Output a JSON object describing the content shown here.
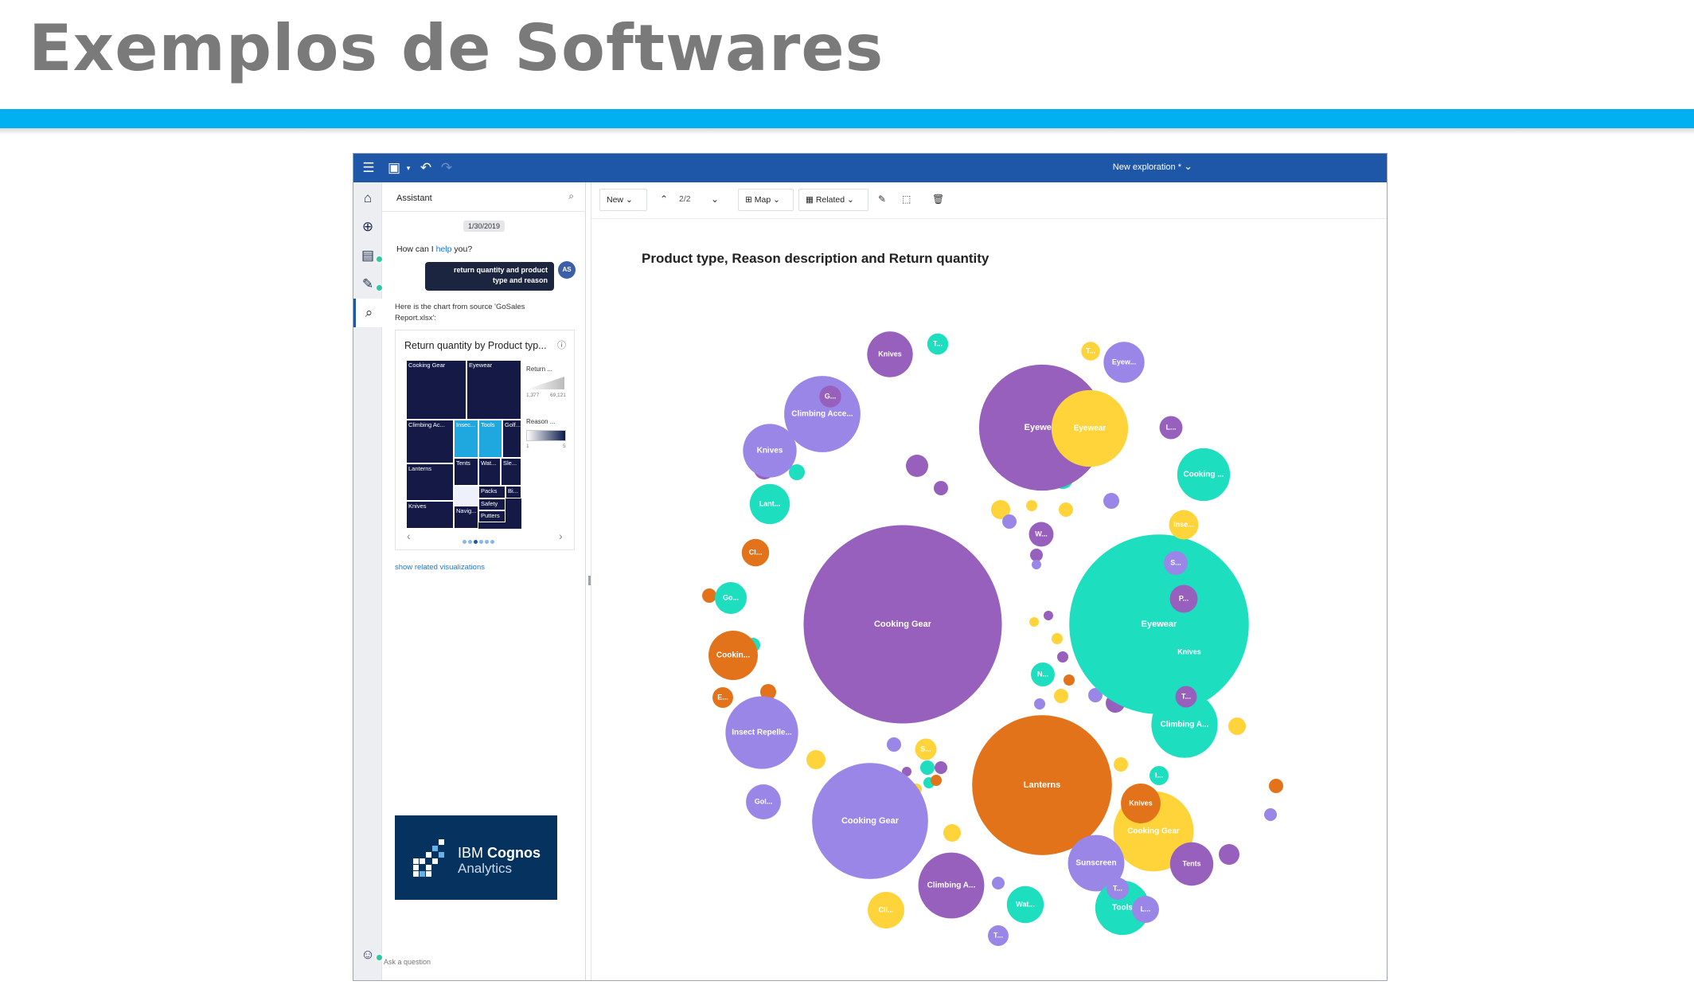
{
  "slide": {
    "title": "Exemplos de Softwares",
    "accent_color": "#00b0f0"
  },
  "app": {
    "topbar": {
      "exploration_title": "New exploration *",
      "color": "#1f57a8"
    },
    "rail": {
      "items": [
        "home",
        "explore",
        "data",
        "pinboard",
        "assistant"
      ]
    },
    "assistant": {
      "title": "Assistant",
      "date": "1/30/2019",
      "question_prefix": "How can I ",
      "question_link": "help",
      "question_suffix": " you?",
      "user_message_line1": "return quantity and product",
      "user_message_line2": "type and reason",
      "avatar": "AS",
      "answer": "Here is the chart from source 'GoSales Report.xlsx':",
      "mini_chart": {
        "title": "Return quantity by Product typ...",
        "legend_return": "Return ...",
        "legend_return_min": "1,377",
        "legend_return_max": "69,121",
        "legend_reason": "Reason ...",
        "legend_reason_min": "1",
        "legend_reason_max": "5",
        "cells": [
          "Cooking Gear",
          "Eyewear",
          "Climbing Ac...",
          "Insec...",
          "Tools",
          "Golf...",
          "Lanterns",
          "Tents",
          "Wat...",
          "Sle...",
          "Knives",
          "Packs",
          "Bi...",
          "Navig...",
          "Safety",
          "Putters"
        ]
      },
      "related_link": "show related visualizations",
      "logo_brand": "IBM",
      "logo_product": "Cognos",
      "logo_sub": "Analytics",
      "ask_placeholder": "Ask a question"
    },
    "toolbar": {
      "new_label": "New",
      "page": "2/2",
      "map_label": "Map",
      "related_label": "Related"
    }
  },
  "chart_data": {
    "type": "packed-bubble",
    "title": "Product type, Reason description and Return quantity",
    "colors": {
      "purple": "#9660bc",
      "lavender": "#9a86e6",
      "teal": "#1edec0",
      "yellow": "#ffd33a",
      "orange": "#e2731a"
    },
    "bubbles": [
      {
        "label": "Cooking Gear",
        "color": "purple",
        "size": 49.9
      },
      {
        "label": "Eyewear",
        "color": "teal",
        "size": 45.2
      },
      {
        "label": "Lanterns",
        "color": "orange",
        "size": 35.2
      },
      {
        "label": "Eyewear",
        "color": "purple",
        "size": 31.7
      },
      {
        "label": "Cooking Gear",
        "color": "lavender",
        "size": 29.2
      },
      {
        "label": "Climbing Acce...",
        "color": "lavender",
        "size": 19.2
      },
      {
        "label": "Cooking Gear",
        "color": "yellow",
        "size": 20.2
      },
      {
        "label": "Eyewear",
        "color": "yellow",
        "size": 19.3
      },
      {
        "label": "Climbing A...",
        "color": "purple",
        "size": 16.6
      },
      {
        "label": "Climbing A...",
        "color": "teal",
        "size": 16.7
      },
      {
        "label": "Insect Repelle...",
        "color": "lavender",
        "size": 18.3
      },
      {
        "label": "Sunscreen",
        "color": "lavender",
        "size": 14.2
      },
      {
        "label": "Knives",
        "color": "lavender",
        "size": 13.5
      },
      {
        "label": "Cookin...",
        "color": "orange",
        "size": 12.4
      },
      {
        "label": "Cooking ...",
        "color": "teal",
        "size": 13.3
      },
      {
        "label": "Knives",
        "color": "teal",
        "size": 12.0
      },
      {
        "label": "Knives",
        "color": "purple",
        "size": 11.5
      },
      {
        "label": "Tools",
        "color": "teal",
        "size": 13.7
      },
      {
        "label": "Tents",
        "color": "purple",
        "size": 10.9
      },
      {
        "label": "Knives",
        "color": "orange",
        "size": 10.0
      },
      {
        "label": "Eyew...",
        "color": "lavender",
        "size": 10.3
      },
      {
        "label": "Lant...",
        "color": "teal",
        "size": 10.1
      },
      {
        "label": "Go...",
        "color": "teal",
        "size": 8.0
      },
      {
        "label": "Gol...",
        "color": "lavender",
        "size": 8.8
      },
      {
        "label": "Wat...",
        "color": "teal",
        "size": 9.3
      },
      {
        "label": "Cli...",
        "color": "yellow",
        "size": 9.2
      },
      {
        "label": "Inse...",
        "color": "yellow",
        "size": 7.4
      },
      {
        "label": "P...",
        "color": "purple",
        "size": 7.0
      },
      {
        "label": "S...",
        "color": "lavender",
        "size": 6.0
      },
      {
        "label": "Cl...",
        "color": "orange",
        "size": 6.9
      },
      {
        "label": "L...",
        "color": "purple",
        "size": 5.8
      },
      {
        "label": "L...",
        "color": "lavender",
        "size": 6.8
      },
      {
        "label": "T...",
        "color": "teal",
        "size": 5.3
      },
      {
        "label": "T...",
        "color": "purple",
        "size": 5.4
      },
      {
        "label": "T...",
        "color": "lavender",
        "size": 5.6
      },
      {
        "label": "T...",
        "color": "lavender",
        "size": 5.2
      },
      {
        "label": "T...",
        "color": "yellow",
        "size": 4.7
      },
      {
        "label": "I...",
        "color": "teal",
        "size": 4.8
      },
      {
        "label": "G...",
        "color": "purple",
        "size": 5.5
      },
      {
        "label": "E...",
        "color": "orange",
        "size": 5.2
      },
      {
        "label": "W...",
        "color": "purple",
        "size": 6.2
      },
      {
        "label": "N...",
        "color": "teal",
        "size": 6.0
      },
      {
        "label": "S...",
        "color": "yellow",
        "size": 5.4
      }
    ]
  }
}
